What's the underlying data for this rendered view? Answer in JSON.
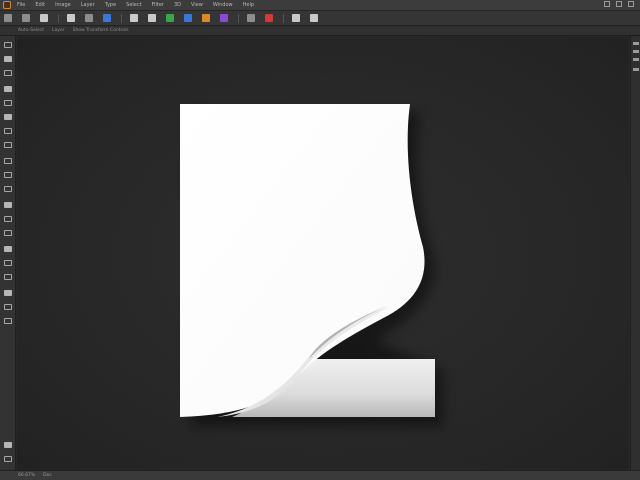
{
  "menubar": {
    "items": [
      "File",
      "Edit",
      "Image",
      "Layer",
      "Type",
      "Select",
      "Filter",
      "3D",
      "View",
      "Window",
      "Help"
    ]
  },
  "toolbar": {
    "icons": [
      "home-icon",
      "move-icon",
      "crop-icon",
      "eyedropper-icon",
      "brush-icon",
      "eraser-icon",
      "gradient-icon",
      "pen-icon",
      "text-icon",
      "shape-icon",
      "hand-icon",
      "zoom-icon"
    ]
  },
  "optionsbar": {
    "items": [
      "Auto-Select",
      "Layer",
      "Show Transform Controls"
    ]
  },
  "statusbar": {
    "items": [
      "66.67%",
      "Doc"
    ]
  },
  "colors": {
    "canvas_bg": "#262626",
    "paper": "#ffffff",
    "ui_panel": "#333333"
  }
}
